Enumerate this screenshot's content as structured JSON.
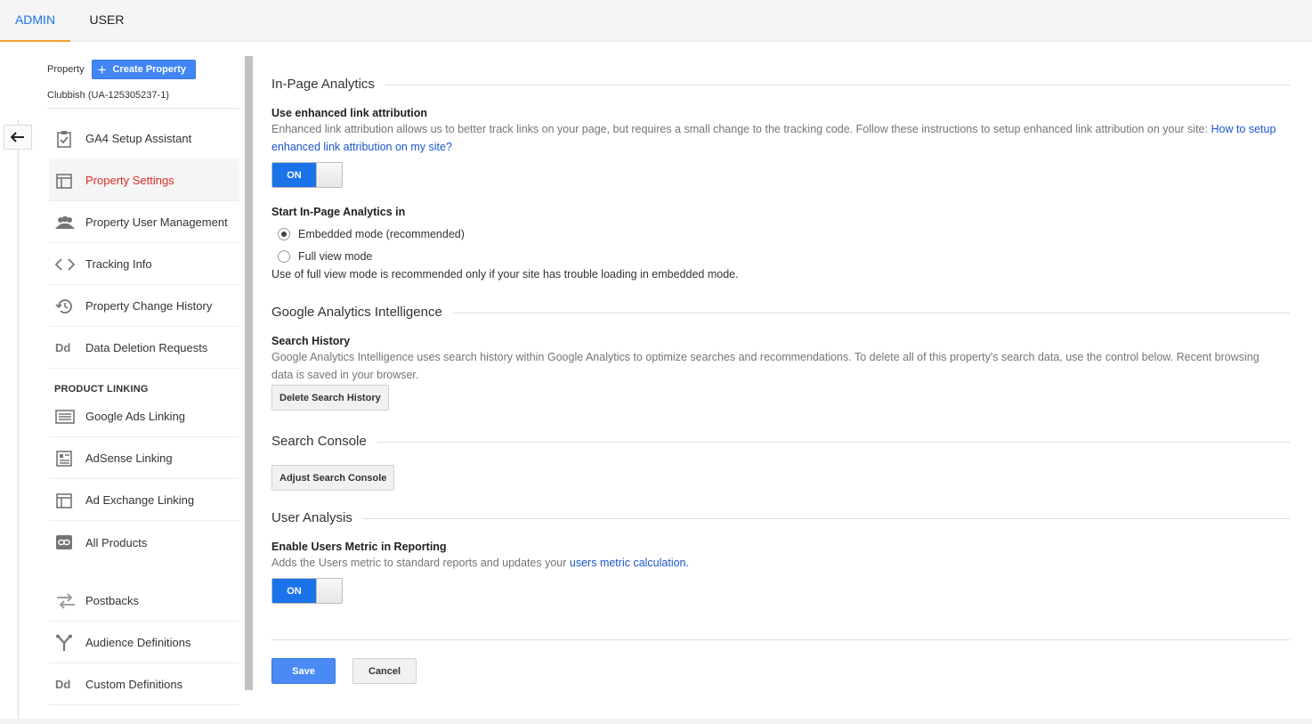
{
  "tabs": {
    "admin": "ADMIN",
    "user": "USER"
  },
  "sidebar": {
    "property_label": "Property",
    "create_property": "Create Property",
    "property_name": "Clubbish (UA-125305237-1)",
    "items": [
      {
        "label": "GA4 Setup Assistant",
        "icon": "clipboard-check-icon"
      },
      {
        "label": "Property Settings",
        "icon": "layout-icon",
        "active": true
      },
      {
        "label": "Property User Management",
        "icon": "people-icon"
      },
      {
        "label": "Tracking Info",
        "icon": "code-icon"
      },
      {
        "label": "Property Change History",
        "icon": "history-icon"
      },
      {
        "label": "Data Deletion Requests",
        "icon": "dd-icon"
      }
    ],
    "product_linking_header": "PRODUCT LINKING",
    "linking_items": [
      {
        "label": "Google Ads Linking",
        "icon": "ads-icon"
      },
      {
        "label": "AdSense Linking",
        "icon": "adsense-icon"
      },
      {
        "label": "Ad Exchange Linking",
        "icon": "ad-exchange-icon"
      },
      {
        "label": "All Products",
        "icon": "link-icon"
      }
    ],
    "other_items": [
      {
        "label": "Postbacks",
        "icon": "postbacks-icon"
      },
      {
        "label": "Audience Definitions",
        "icon": "audience-icon"
      },
      {
        "label": "Custom Definitions",
        "icon": "dd-icon"
      }
    ]
  },
  "main": {
    "in_page": {
      "title": "In-Page Analytics",
      "enhanced_label": "Use enhanced link attribution",
      "enhanced_desc": "Enhanced link attribution allows us to better track links on your page, but requires a small change to the tracking code. Follow these instructions to setup enhanced link attribution on your site:",
      "enhanced_link": "How to setup enhanced link attribution on my site?",
      "toggle_on": "ON",
      "start_label": "Start In-Page Analytics in",
      "radio_embedded": "Embedded mode (recommended)",
      "radio_full": "Full view mode",
      "full_view_note": "Use of full view mode is recommended only if your site has trouble loading in embedded mode."
    },
    "intelligence": {
      "title": "Google Analytics Intelligence",
      "search_history_label": "Search History",
      "search_history_desc": "Google Analytics Intelligence uses search history within Google Analytics to optimize searches and recommendations. To delete all of this property's search data, use the control below. Recent browsing data is saved in your browser.",
      "delete_button": "Delete Search History"
    },
    "search_console": {
      "title": "Search Console",
      "adjust_button": "Adjust Search Console"
    },
    "user_analysis": {
      "title": "User Analysis",
      "users_metric_label": "Enable Users Metric in Reporting",
      "users_metric_desc": "Adds the Users metric to standard reports and updates your",
      "users_metric_link": "users metric calculation.",
      "toggle_on": "ON"
    },
    "actions": {
      "save": "Save",
      "cancel": "Cancel"
    }
  },
  "colors": {
    "accent_blue": "#1a73e8",
    "active_red": "#d93025",
    "tab_underline": "#f0a030"
  }
}
